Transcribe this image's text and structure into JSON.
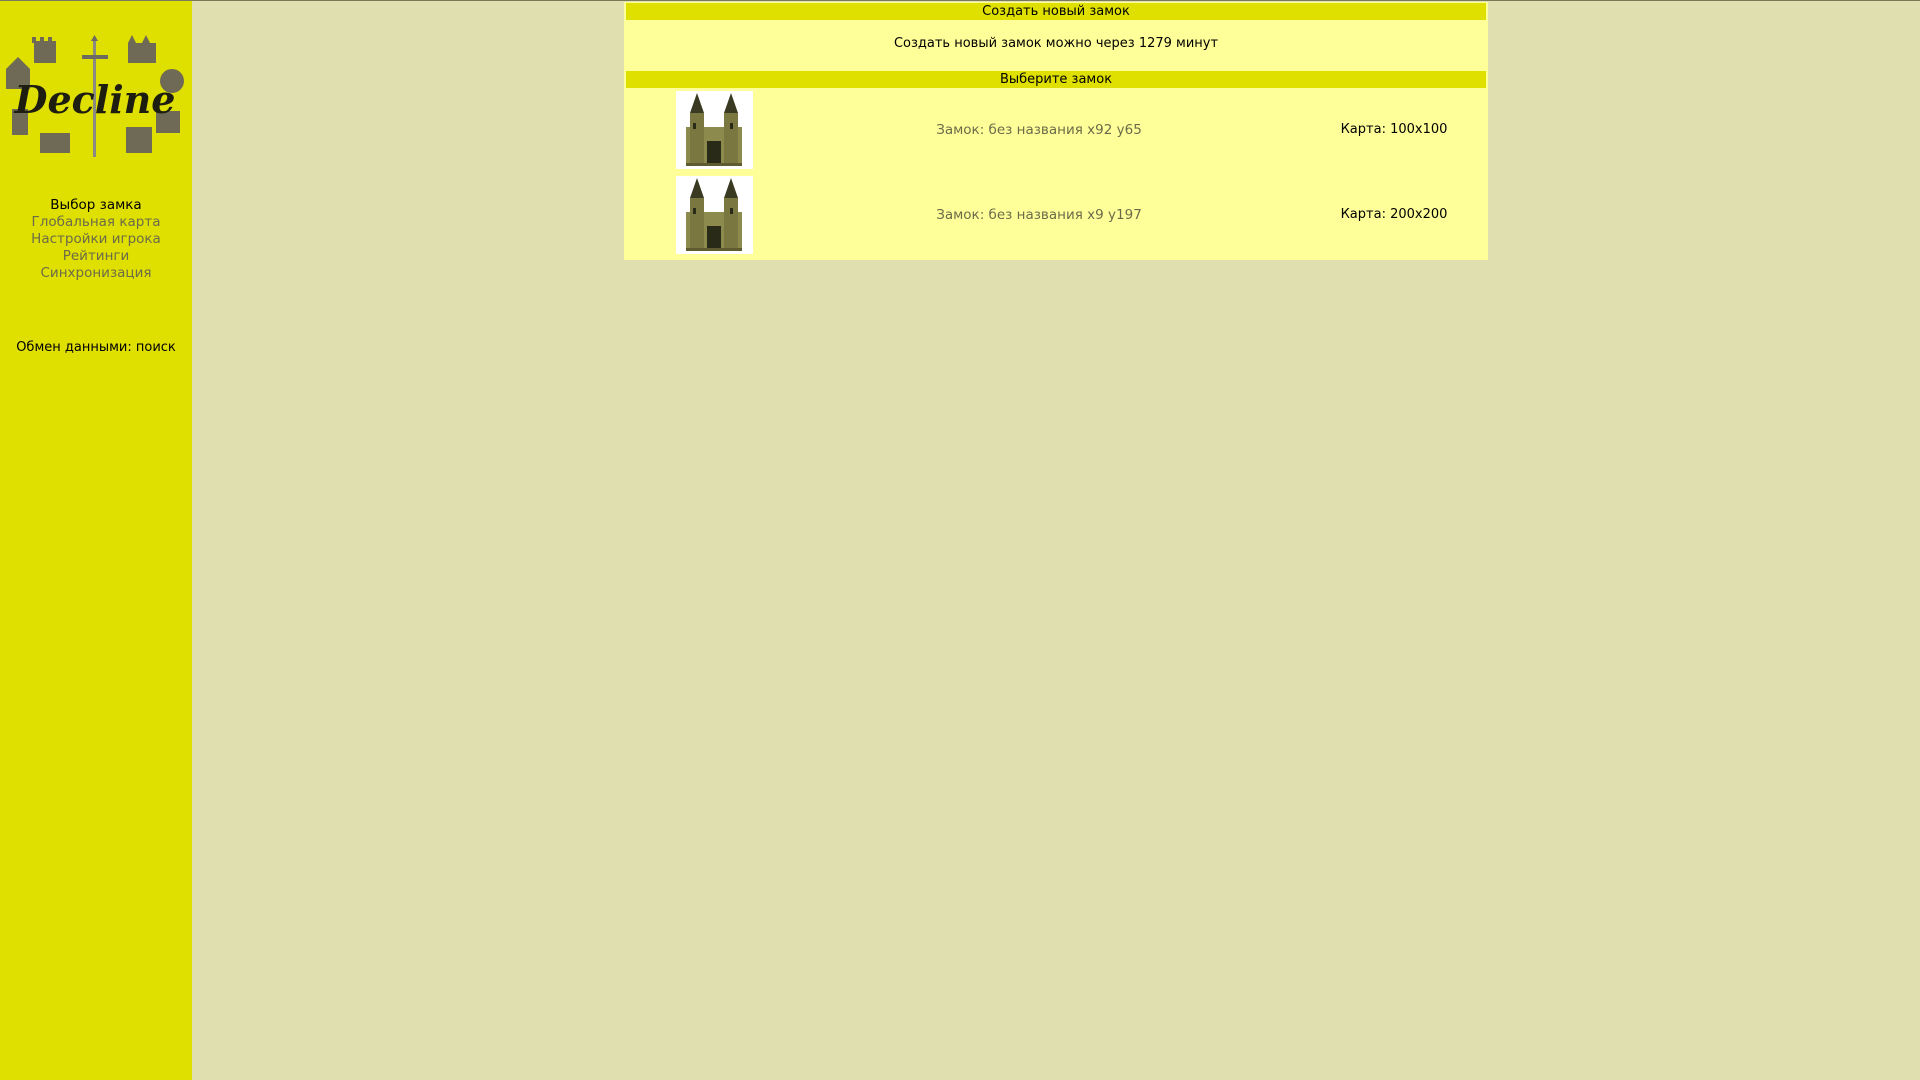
{
  "sidebar": {
    "logo_text": "Decline",
    "nav": [
      {
        "label": "Выбор замка",
        "current": true
      },
      {
        "label": "Глобальная карта",
        "current": false
      },
      {
        "label": "Настройки игрока",
        "current": false
      },
      {
        "label": "Рейтинги",
        "current": false
      },
      {
        "label": "Синхронизация",
        "current": false
      }
    ],
    "exchange_status": "Обмен данными: поиск"
  },
  "create_section": {
    "header": "Создать новый замок",
    "notice": "Создать новый замок можно через 1279 минут"
  },
  "select_section": {
    "header": "Выберите замок",
    "castles": [
      {
        "name": "Замок: без названия x92 y65",
        "map": "Карта: 100x100",
        "icon": "castle-icon"
      },
      {
        "name": "Замок: без названия x9 y197",
        "map": "Карта: 200x200",
        "icon": "castle-icon"
      }
    ]
  },
  "colors": {
    "page_bg": "#dfdfaf",
    "sidebar_bg": "#dfdf00",
    "panel_bg": "#ffff99",
    "header_bg": "#dfdf00",
    "link": "#6b6b4a"
  }
}
